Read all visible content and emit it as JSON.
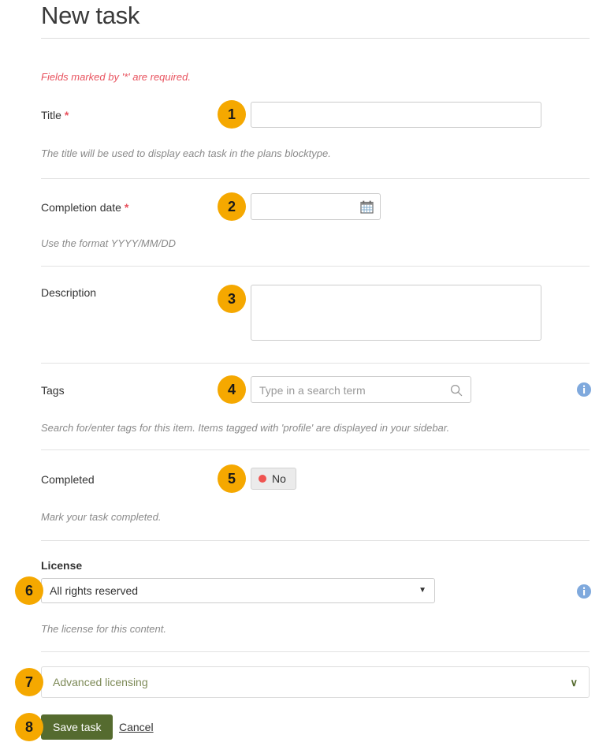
{
  "header": {
    "title": "New task"
  },
  "notice": {
    "required_text": "Fields marked by '*' are required."
  },
  "colors": {
    "badge_orange": "#f5a800",
    "required_red": "#e8525e",
    "save_green": "#556b2f",
    "info_blue": "#7fa9dd",
    "status_red": "#ef5350"
  },
  "fields": {
    "title": {
      "label": "Title",
      "required_marker": "*",
      "value": "",
      "placeholder": "",
      "help": "The title will be used to display each task in the plans blocktype.",
      "step": "1"
    },
    "completion_date": {
      "label": "Completion date",
      "required_marker": "*",
      "value": "",
      "placeholder": "",
      "help": "Use the format YYYY/MM/DD",
      "icon": "calendar-icon",
      "step": "2"
    },
    "description": {
      "label": "Description",
      "value": "",
      "placeholder": "",
      "step": "3"
    },
    "tags": {
      "label": "Tags",
      "placeholder": "Type in a search term",
      "value": "",
      "help": "Search for/enter tags for this item. Items tagged with 'profile' are displayed in your sidebar.",
      "search_icon": "search-icon",
      "info_icon": "info-icon",
      "step": "4"
    },
    "completed": {
      "label": "Completed",
      "toggle_value": "No",
      "help": "Mark your task completed.",
      "step": "5"
    },
    "license": {
      "label": "License",
      "selected": "All rights reserved",
      "caret": "▼",
      "help": "The license for this content.",
      "info_icon": "info-icon",
      "step": "6"
    },
    "advanced_licensing": {
      "label": "Advanced licensing",
      "chevron": "∨",
      "step": "7"
    }
  },
  "actions": {
    "save_label": "Save task",
    "cancel_label": "Cancel",
    "step": "8"
  }
}
